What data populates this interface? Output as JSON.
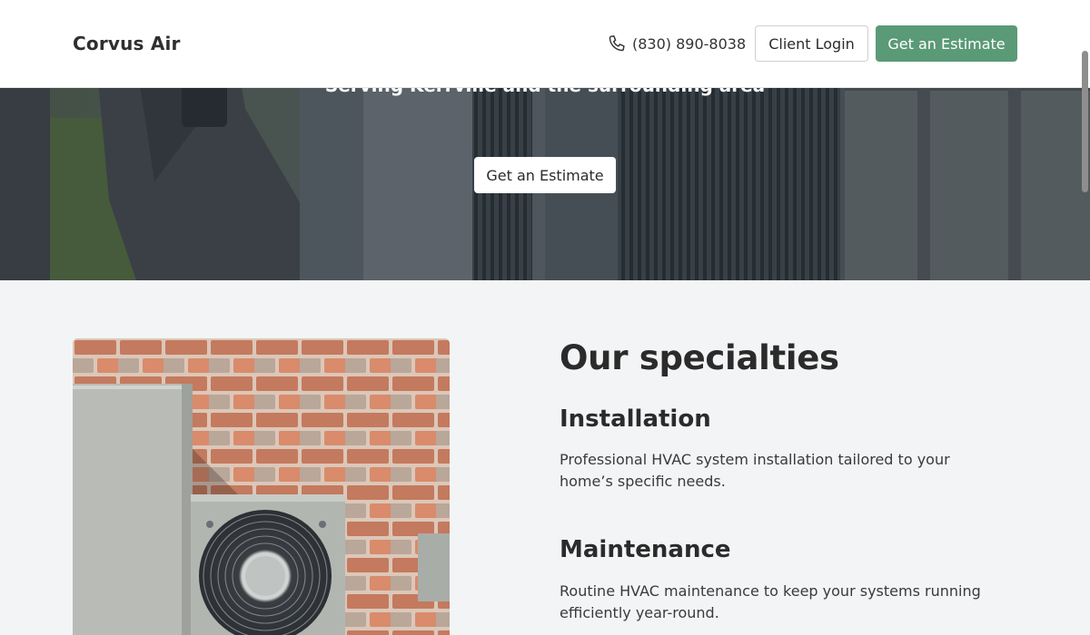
{
  "header": {
    "brand": "Corvus Air",
    "phone": "(830) 890-8038",
    "login_label": "Client Login",
    "estimate_label": "Get an Estimate"
  },
  "hero": {
    "subtitle": "Serving Kerrville and the surrounding area",
    "estimate_label": "Get an Estimate"
  },
  "specialties": {
    "heading": "Our specialties",
    "items": [
      {
        "title": "Installation",
        "description": "Professional HVAC system installation tailored to your home’s specific needs."
      },
      {
        "title": "Maintenance",
        "description": "Routine HVAC maintenance to keep your systems running efficiently year-round."
      }
    ]
  },
  "colors": {
    "accent": "#5a9a77",
    "background": "#f3f4f6",
    "text": "#2b2b2b"
  },
  "icons": {
    "phone": "phone-icon"
  }
}
